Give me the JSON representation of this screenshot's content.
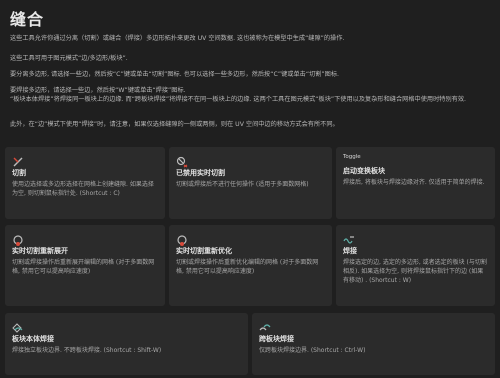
{
  "title": "缝合",
  "intro": [
    "这些工具允许你通过分离（切割）或缝合（焊接）多边形拓扑来更改 UV 空间数据. 这也被称为在模型中生成“缝隙”的操作.",
    "这些工具可用于图元模式“边/多边形/板块”.",
    "要分离多边形, 请选择一些边，然后按“C”键或单击“切割”图标. 也可以选择一些多边形，然后按“C”键或单击“切割”图标.",
    "要焊接多边形，请选择一些边，然后按“W”键或单击“焊接”图标.",
    "“板块本体焊接”将焊接同一板块上的边缘. 而“跨板块焊接”将焊接不在同一板块上的边缘. 这两个工具在图元模式“板块”下使用以及复杂形和缝合网格中使用时特别有效.",
    "此外，在“边”模式下使用“焊接”时，请注意，如果仅选择缝隙的一侧或两侧，则在 UV 空间中边的移动方式会有所不同。"
  ],
  "cards": [
    {
      "badge": "",
      "title": "切割",
      "desc": "使用边选择或多边形选择在网格上创建缝隙. 如果选择为空, 则切割鼠标指针处. (Shortcut : C)",
      "icon": "cut-icon"
    },
    {
      "badge": "",
      "title": "已禁用实时切割",
      "desc": "切割或焊接后不进行任何操作 (适用于多面数网格)",
      "icon": "cut-disabled-icon"
    },
    {
      "badge": "Toggle",
      "title": "启动变换板块",
      "desc": "焊接后, 将板块与焊接边缘对齐. 仅适用于简单的焊接.",
      "icon": ""
    },
    {
      "badge": "",
      "title": "实时切割重新展开",
      "desc": "切割或焊接操作后重新展开编辑的网格 (对于多面数网格, 禁用它可以提高响应速度)",
      "icon": "cut-unfold-icon"
    },
    {
      "badge": "",
      "title": "实时切割重新优化",
      "desc": "切割或焊接操作后重新优化编辑的网格 (对于多面数网格, 禁用它可以提高响应速度)",
      "icon": "cut-optimize-icon"
    },
    {
      "badge": "",
      "title": "焊接",
      "desc": "焊接选定的边, 选定的多边形, 或者选定的板块 (与切割相反). 如果选择为空, 则将焊接鼠标指针下的边 (如果有移动) . (Shortcut : W)",
      "icon": "weld-icon"
    },
    {
      "badge": "",
      "title": "板块本体焊接",
      "desc": "焊接独立板块边界. 不跨板块焊接. (Shortcut : Shift-W)",
      "icon": "self-weld-icon"
    },
    {
      "badge": "",
      "title": "跨板块焊接",
      "desc": "仅跨板块焊接边界. (Shortcut : Ctrl-W)",
      "icon": "cross-weld-icon"
    }
  ],
  "colors": {
    "accent_red": "#d64a3a",
    "icon_gray": "#bdbdbd",
    "icon_teal": "#5fb0a8"
  }
}
